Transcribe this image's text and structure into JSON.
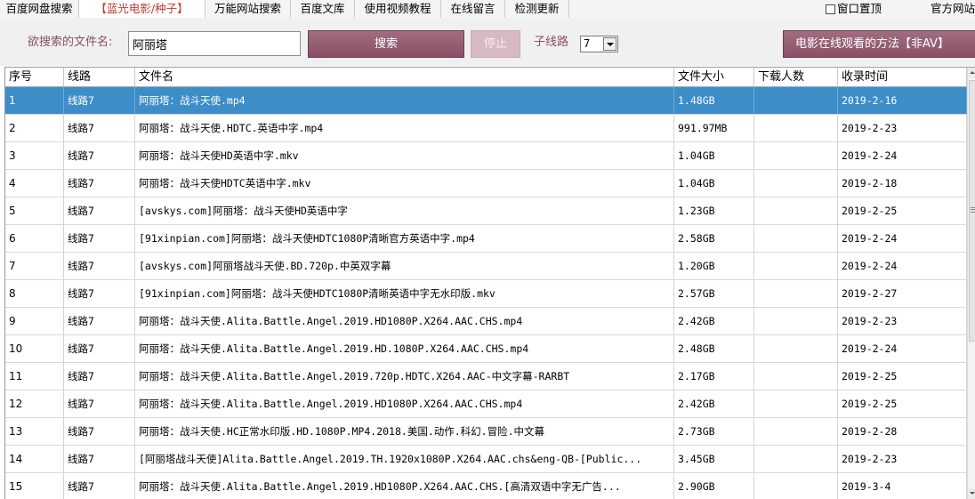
{
  "tabs": [
    {
      "label": "百度网盘搜索",
      "active": false
    },
    {
      "label": "【蓝光电影/种子】",
      "active": true
    },
    {
      "label": "万能网站搜索",
      "active": false
    },
    {
      "label": "百度文库",
      "active": false
    },
    {
      "label": "使用视频教程",
      "active": false
    },
    {
      "label": "在线留言",
      "active": false
    },
    {
      "label": "检测更新",
      "active": false
    }
  ],
  "top_options": {
    "window_top_label": "窗口置顶",
    "window_top_checked": false,
    "official_site_label": "官方网站"
  },
  "search": {
    "filename_label": "欲搜索的文件名:",
    "filename_value": "阿丽塔",
    "search_label": "搜索",
    "stop_label": "停止",
    "subline_label": "子线路",
    "subline_value": "7",
    "movie_help_label": "电影在线观看的方法【非AV】"
  },
  "colors": {
    "accent": "#8a5066",
    "selected_row": "#3d8dc8",
    "active_tab_text": "#c23a30"
  },
  "table": {
    "columns": [
      "序号",
      "线路",
      "文件名",
      "文件大小",
      "下载人数",
      "收录时间"
    ],
    "selected_index": 0,
    "rows": [
      {
        "no": "1",
        "line": "线路7",
        "name": "阿丽塔：战斗天使.mp4",
        "size": "1.48GB",
        "downloads": "",
        "date": "2019-2-16"
      },
      {
        "no": "2",
        "line": "线路7",
        "name": "阿丽塔：战斗天使.HDTC.英语中字.mp4",
        "size": "991.97MB",
        "downloads": "",
        "date": "2019-2-23"
      },
      {
        "no": "3",
        "line": "线路7",
        "name": "阿丽塔：战斗天使HD英语中字.mkv",
        "size": "1.04GB",
        "downloads": "",
        "date": "2019-2-24"
      },
      {
        "no": "4",
        "line": "线路7",
        "name": "阿丽塔：战斗天使HDTC英语中字.mkv",
        "size": "1.04GB",
        "downloads": "",
        "date": "2019-2-18"
      },
      {
        "no": "5",
        "line": "线路7",
        "name": "[avskys.com]阿丽塔：战斗天使HD英语中字",
        "size": "1.23GB",
        "downloads": "",
        "date": "2019-2-25"
      },
      {
        "no": "6",
        "line": "线路7",
        "name": "[91xinpian.com]阿丽塔：战斗天使HDTC1080P清晰官方英语中字.mp4",
        "size": "2.58GB",
        "downloads": "",
        "date": "2019-2-24"
      },
      {
        "no": "7",
        "line": "线路7",
        "name": "[avskys.com]阿丽塔战斗天使.BD.720p.中英双字幕",
        "size": "1.20GB",
        "downloads": "",
        "date": "2019-2-24"
      },
      {
        "no": "8",
        "line": "线路7",
        "name": "[91xinpian.com]阿丽塔：战斗天使HDTC1080P清晰英语中字无水印版.mkv",
        "size": "2.57GB",
        "downloads": "",
        "date": "2019-2-27"
      },
      {
        "no": "9",
        "line": "线路7",
        "name": "阿丽塔：战斗天使.Alita.Battle.Angel.2019.HD1080P.X264.AAC.CHS.mp4",
        "size": "2.42GB",
        "downloads": "",
        "date": "2019-2-23"
      },
      {
        "no": "10",
        "line": "线路7",
        "name": "阿丽塔：战斗天使.Alita.Battle.Angel.2019.HD.1080P.X264.AAC.CHS.mp4",
        "size": "2.48GB",
        "downloads": "",
        "date": "2019-2-24"
      },
      {
        "no": "11",
        "line": "线路7",
        "name": "阿丽塔：战斗天使.Alita.Battle.Angel.2019.720p.HDTC.X264.AAC-中文字幕-RARBT",
        "size": "2.17GB",
        "downloads": "",
        "date": "2019-2-25"
      },
      {
        "no": "12",
        "line": "线路7",
        "name": "阿丽塔：战斗天使.Alita.Battle.Angel.2019.HD1080P.X264.AAC.CHS.mp4",
        "size": "2.42GB",
        "downloads": "",
        "date": "2019-2-25"
      },
      {
        "no": "13",
        "line": "线路7",
        "name": "阿丽塔：战斗天使.HC正常水印版.HD.1080P.MP4.2018.美国.动作.科幻.冒险.中文幕",
        "size": "2.73GB",
        "downloads": "",
        "date": "2019-2-28"
      },
      {
        "no": "14",
        "line": "线路7",
        "name": "[阿丽塔战斗天使]Alita.Battle.Angel.2019.TH.1920x1080P.X264.AAC.chs&eng-QB-[Public...",
        "size": "3.45GB",
        "downloads": "",
        "date": "2019-2-23"
      },
      {
        "no": "15",
        "line": "线路7",
        "name": "阿丽塔：战斗天使.Alita.Battle.Angel.2019.HD1080P.X264.AAC.CHS.[高清双语中字无广告...",
        "size": "2.90GB",
        "downloads": "",
        "date": "2019-3-4"
      }
    ]
  }
}
